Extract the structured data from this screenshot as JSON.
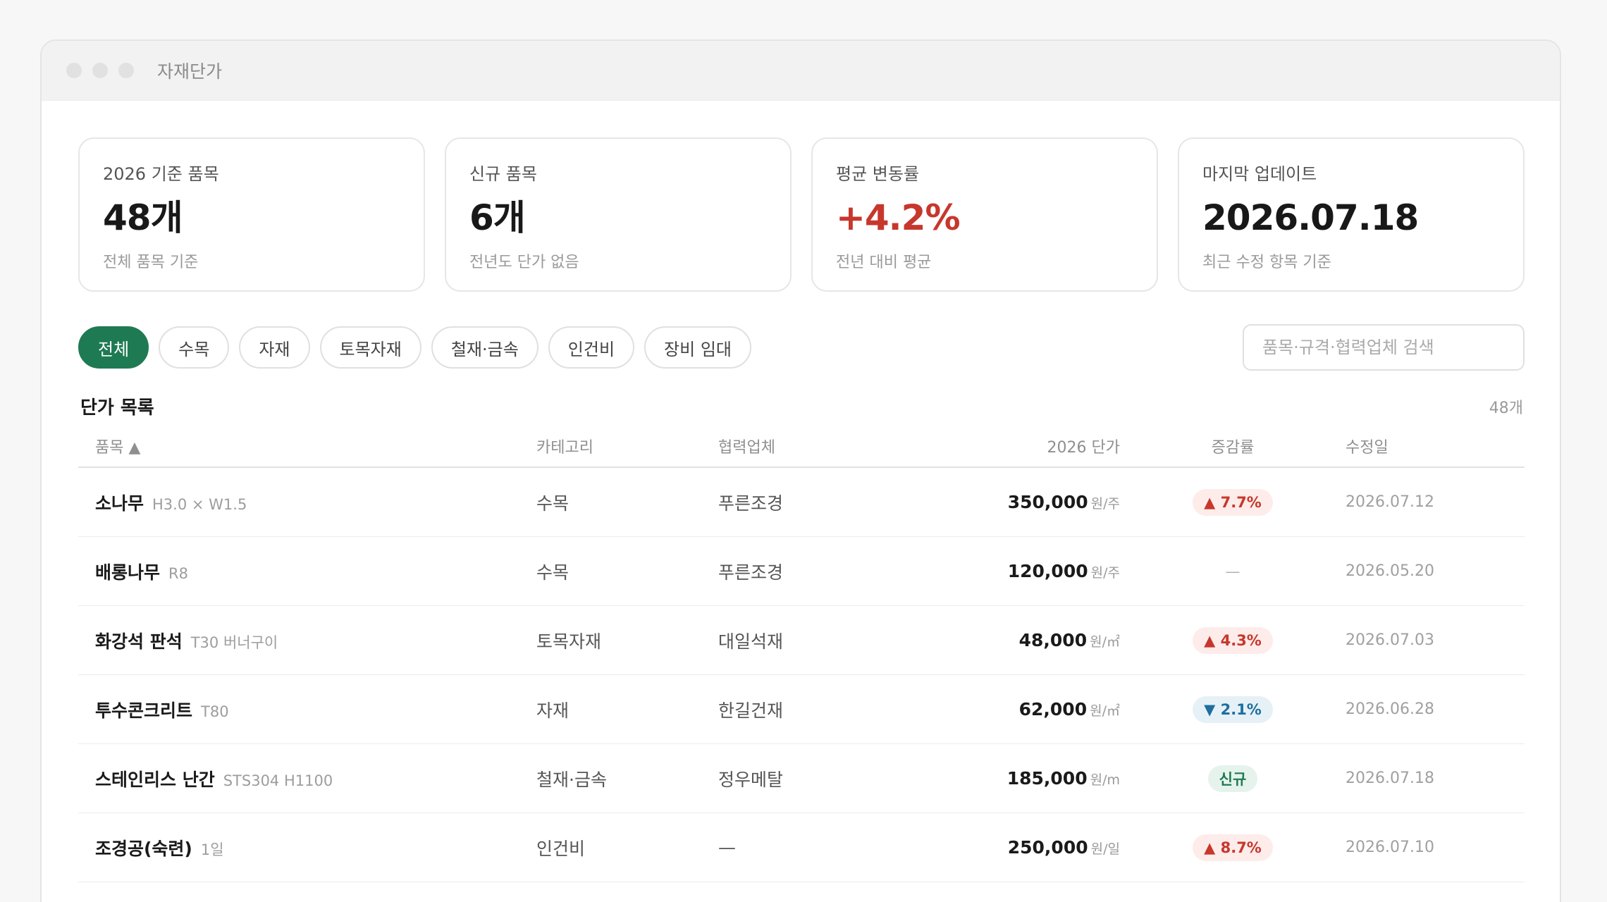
{
  "window": {
    "title": "자재단가"
  },
  "summary": [
    {
      "label": "2026 기준 품목",
      "value": "48개",
      "sub": "전체 품목 기준"
    },
    {
      "label": "신규 품목",
      "value": "6개",
      "sub": "전년도 단가 없음"
    },
    {
      "label": "평균 변동률",
      "value": "+4.2%",
      "sub": "전년 대비 평균"
    },
    {
      "label": "마지막 업데이트",
      "value": "2026.07.18",
      "sub": "최근 수정 항목 기준"
    }
  ],
  "filters": [
    "전체",
    "수목",
    "자재",
    "토목자재",
    "철재·금속",
    "인건비",
    "장비 임대"
  ],
  "search": {
    "placeholder": "품목·규격·협력업체 검색"
  },
  "list": {
    "title": "단가 목록",
    "count": "48개"
  },
  "table": {
    "headers": {
      "name": "품목 ▲",
      "category": "카테고리",
      "vendor": "협력업체",
      "price": "2026 단가",
      "change": "증감률",
      "date": "수정일"
    },
    "rows": [
      {
        "name": "소나무",
        "spec": "H3.0 × W1.5",
        "category": "수목",
        "vendor": "푸른조경",
        "price": "350,000",
        "unit": "원/주",
        "change": "▲ 7.7%",
        "change_type": "up",
        "date": "2026.07.12"
      },
      {
        "name": "배롱나무",
        "spec": "R8",
        "category": "수목",
        "vendor": "푸른조경",
        "price": "120,000",
        "unit": "원/주",
        "change": "—",
        "change_type": "none",
        "date": "2026.05.20"
      },
      {
        "name": "화강석 판석",
        "spec": "T30 버너구이",
        "category": "토목자재",
        "vendor": "대일석재",
        "price": "48,000",
        "unit": "원/㎡",
        "change": "▲ 4.3%",
        "change_type": "up",
        "date": "2026.07.03"
      },
      {
        "name": "투수콘크리트",
        "spec": "T80",
        "category": "자재",
        "vendor": "한길건재",
        "price": "62,000",
        "unit": "원/㎡",
        "change": "▼ 2.1%",
        "change_type": "down",
        "date": "2026.06.28"
      },
      {
        "name": "스테인리스 난간",
        "spec": "STS304 H1100",
        "category": "철재·금속",
        "vendor": "정우메탈",
        "price": "185,000",
        "unit": "원/m",
        "change": "신규",
        "change_type": "new",
        "date": "2026.07.18"
      },
      {
        "name": "조경공(숙련)",
        "spec": "1일",
        "category": "인건비",
        "vendor": "—",
        "price": "250,000",
        "unit": "원/일",
        "change": "▲ 8.7%",
        "change_type": "up",
        "date": "2026.07.10"
      }
    ]
  },
  "colors": {
    "accent": "#1e7a52",
    "up": "#c7372c",
    "down": "#1d6f9f"
  }
}
